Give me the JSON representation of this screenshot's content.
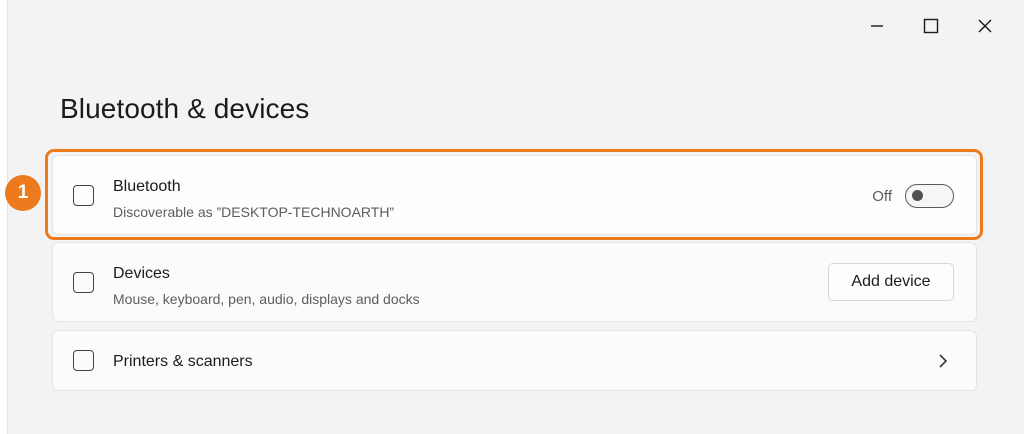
{
  "window": {
    "controls": [
      "minimize",
      "maximize",
      "close"
    ]
  },
  "page": {
    "title": "Bluetooth & devices"
  },
  "annotation": {
    "step_number": "1",
    "highlight_color": "#ee7a1e"
  },
  "bluetooth": {
    "title": "Bluetooth",
    "subtitle": "Discoverable as ”DESKTOP-TECHNOARTH”",
    "toggle_label": "Off",
    "toggle_on": false
  },
  "devices": {
    "title": "Devices",
    "subtitle": "Mouse, keyboard, pen, audio, displays and docks",
    "button_label": "Add device"
  },
  "printers": {
    "title": "Printers & scanners"
  }
}
